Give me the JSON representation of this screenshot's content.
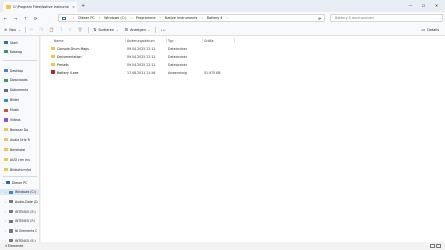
{
  "window": {
    "tab_title": "C:\\Program Files\\Native Instrume",
    "tab_close": "×",
    "new_tab": "+",
    "minimize": "—",
    "maximize": "☐",
    "close": "✕"
  },
  "nav_buttons": {
    "back": "←",
    "forward": "→",
    "up": "↑",
    "refresh": "⟳"
  },
  "breadcrumbs": [
    "Dieser PC",
    "Windows (C:)",
    "Programme",
    "Native Instruments",
    "Battery 4"
  ],
  "breadcrumb_separator": "›",
  "address_dropdown": "⌄",
  "search": {
    "placeholder": "Battery 4 durchsuchen"
  },
  "toolbar": {
    "new": "Neu",
    "sort": "Sortieren",
    "view": "Anzeigen",
    "more": "•••",
    "details": "Details"
  },
  "sidebar": {
    "quick": [
      {
        "label": "Start",
        "color": "#2b6cb0"
      },
      {
        "label": "Katalog",
        "color": "#2e9d5a"
      }
    ],
    "pinned": [
      {
        "label": "Desktop",
        "color": "#3a86d6"
      },
      {
        "label": "Downloads",
        "color": "#2e9d5a"
      },
      {
        "label": "Dokumente",
        "color": "#5a6b80"
      },
      {
        "label": "Bilder",
        "color": "#3a86d6"
      },
      {
        "label": "Musik",
        "color": "#d44a3a"
      },
      {
        "label": "Videos",
        "color": "#8a4fd6"
      },
      {
        "label": "Browser Do",
        "color": "#f4c542"
      },
      {
        "label": "Audio Urle R",
        "color": "#f4c542"
      },
      {
        "label": "Bereitstel",
        "color": "#f4c542"
      },
      {
        "label": "AUD crm mu",
        "color": "#f4c542"
      },
      {
        "label": "Bildschirmfot",
        "color": "#f4c542"
      }
    ],
    "tree": [
      {
        "label": "Dieser PC",
        "chevron": "⌄",
        "color": "#2b6cb0"
      },
      {
        "label": "Windows (C:)",
        "chevron": "›",
        "color": "#3a86d6"
      },
      {
        "label": "Audio-Date (D",
        "chevron": "›",
        "color": "#777777"
      },
      {
        "label": "INTENSO (E:)",
        "chevron": "›",
        "color": "#777777"
      },
      {
        "label": "INTENSO (F:)",
        "chevron": "›",
        "color": "#777777"
      },
      {
        "label": "NI Elements C",
        "chevron": "›",
        "color": "#777777"
      },
      {
        "label": "INTENSO (E:)",
        "chevron": "›",
        "color": "#777777"
      }
    ]
  },
  "columns": {
    "name": "Name",
    "date": "Änderungsdatum",
    "type": "Typ",
    "size": "Größe"
  },
  "files": [
    {
      "name": "Console Drum Maps",
      "date": "09.04.2025 22:11",
      "type": "Dateiordner",
      "size": "",
      "kind": "folder"
    },
    {
      "name": "Documentation",
      "date": "09.04.2025 22:11",
      "type": "Dateiordner",
      "size": "",
      "kind": "folder"
    },
    {
      "name": "Presets",
      "date": "09.04.2025 22:11",
      "type": "Dateiordner",
      "size": "",
      "kind": "folder"
    },
    {
      "name": "Battery 4.exe",
      "date": "17.08.2021 11:56",
      "type": "Anwendung",
      "size": "51.975 KB",
      "kind": "app"
    }
  ],
  "status": {
    "count": "4 Elemente"
  }
}
